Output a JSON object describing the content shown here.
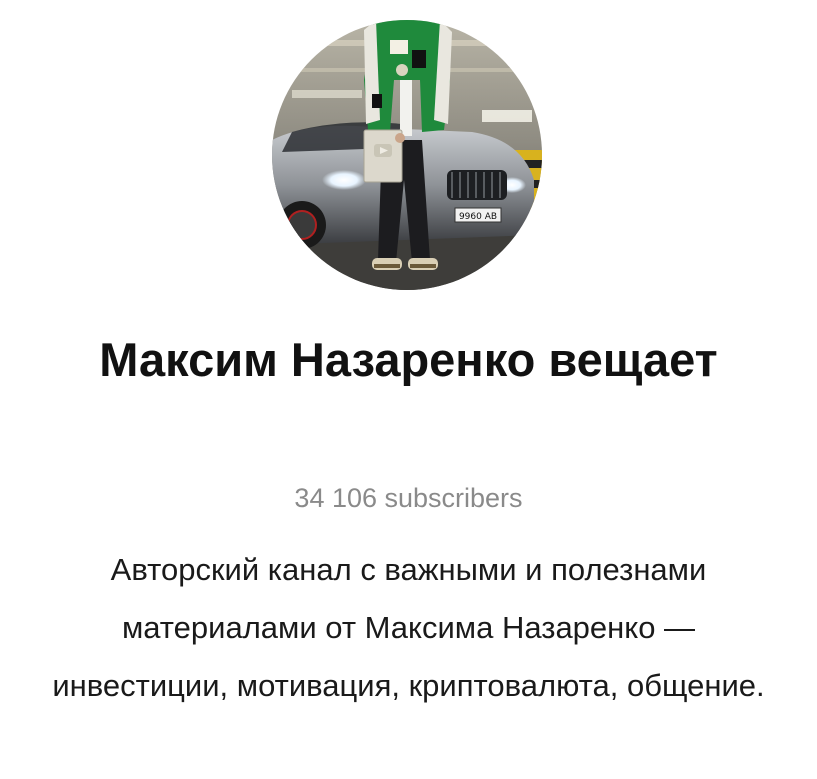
{
  "channel": {
    "title": "Максим Назаренко вещает",
    "subscribers": "34 106 subscribers",
    "description": "Авторский канал с важными и полезнами материалами от Максима Назаренко — инвестиции, мотивация, криптовалюта, общение.",
    "avatar": {
      "icon": "avatar-photo-icon",
      "plate_text": "9960 AB"
    }
  },
  "colors": {
    "title": "#111111",
    "subscribers": "#8a8a8a",
    "description": "#1a1a1a",
    "background": "#ffffff"
  }
}
